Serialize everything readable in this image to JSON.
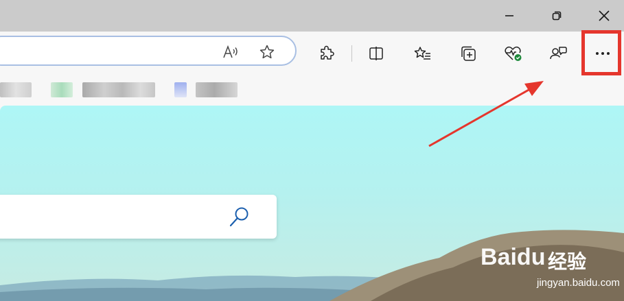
{
  "window_controls": {
    "minimize_icon": "minimize-icon",
    "restore_icon": "restore-icon",
    "close_icon": "close-icon"
  },
  "toolbar": {
    "address_value": "",
    "icons": [
      "read-aloud-icon",
      "favorite-star-icon",
      "extensions-icon",
      "split-screen-icon",
      "favorites-icon",
      "collections-icon",
      "browser-essentials-icon",
      "profile-icon",
      "more-options-icon"
    ]
  },
  "content": {
    "search_value": ""
  },
  "watermark": {
    "logo": "Bai",
    "logo_suffix": "du",
    "chinese": "经验",
    "url": "jingyan.baidu.com"
  },
  "colors": {
    "titlebar": "#cbcbcb",
    "toolbar": "#f7f7f7",
    "address_border": "#a8bfe3",
    "highlight": "#e5362d",
    "browser_essentials_badge": "#1e8a3c"
  }
}
